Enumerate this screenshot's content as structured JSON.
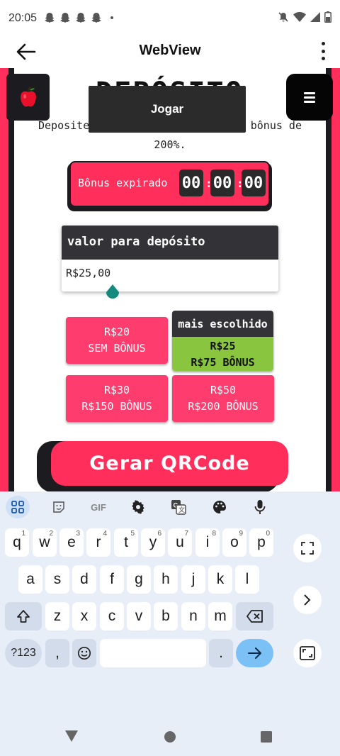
{
  "status_bar": {
    "time": "20:05",
    "icons": [
      "snapchat-icon",
      "snapchat-icon",
      "snapchat-icon",
      "snapchat-icon",
      "notification-dot-icon",
      "mute-icon",
      "wifi-icon",
      "signal-icon",
      "battery-icon"
    ]
  },
  "app_bar": {
    "title": "WebView",
    "back_icon": "arrow-left-icon",
    "menu_icon": "more-vert-icon"
  },
  "page": {
    "title_peek": "DEPÓSITO",
    "description_line1_left": "Deposite",
    "description_line1_right": "bônus de",
    "description_line2": "200%.",
    "jogar_label": "Jogar",
    "apple_icon": "apple-icon",
    "menu_icon": "hamburger-icon",
    "bonus": {
      "label": "Bônus expirado",
      "hours": "00",
      "minutes": "00",
      "seconds": "00",
      "separator": ":"
    },
    "deposit": {
      "header": "valor para depósito",
      "value": "R$25,00"
    },
    "options": [
      {
        "line1": "R$20",
        "line2": "SEM BÔNUS"
      },
      {
        "badge": "mais escolhido",
        "line1": "R$25",
        "line2": "R$75 BÔNUS"
      },
      {
        "line1": "R$30",
        "line2": "R$150 BÔNUS"
      },
      {
        "line1": "R$50",
        "line2": "R$200 BÔNUS"
      }
    ],
    "generate_label": "Gerar QRCode"
  },
  "keyboard": {
    "toolbar": [
      "apps-grid-icon",
      "sticker-icon",
      "gif-icon",
      "settings-icon",
      "translate-icon",
      "palette-icon",
      "microphone-icon"
    ],
    "gif_label": "GIF",
    "row1": [
      "q",
      "w",
      "e",
      "r",
      "t",
      "y",
      "u",
      "i",
      "o",
      "p"
    ],
    "row1_hints": [
      "1",
      "2",
      "3",
      "4",
      "5",
      "6",
      "7",
      "8",
      "9",
      "0"
    ],
    "row2": [
      "a",
      "s",
      "d",
      "f",
      "g",
      "h",
      "j",
      "k",
      "l"
    ],
    "row3": [
      "z",
      "x",
      "c",
      "v",
      "b",
      "n",
      "m"
    ],
    "symbols_label": "?123",
    "comma_label": ",",
    "period_label": "."
  },
  "colors": {
    "accent_pink": "#ff2e5b",
    "dark": "#1c1b1f",
    "green": "#8ac540",
    "keyboard_bg": "#e8eef7"
  }
}
